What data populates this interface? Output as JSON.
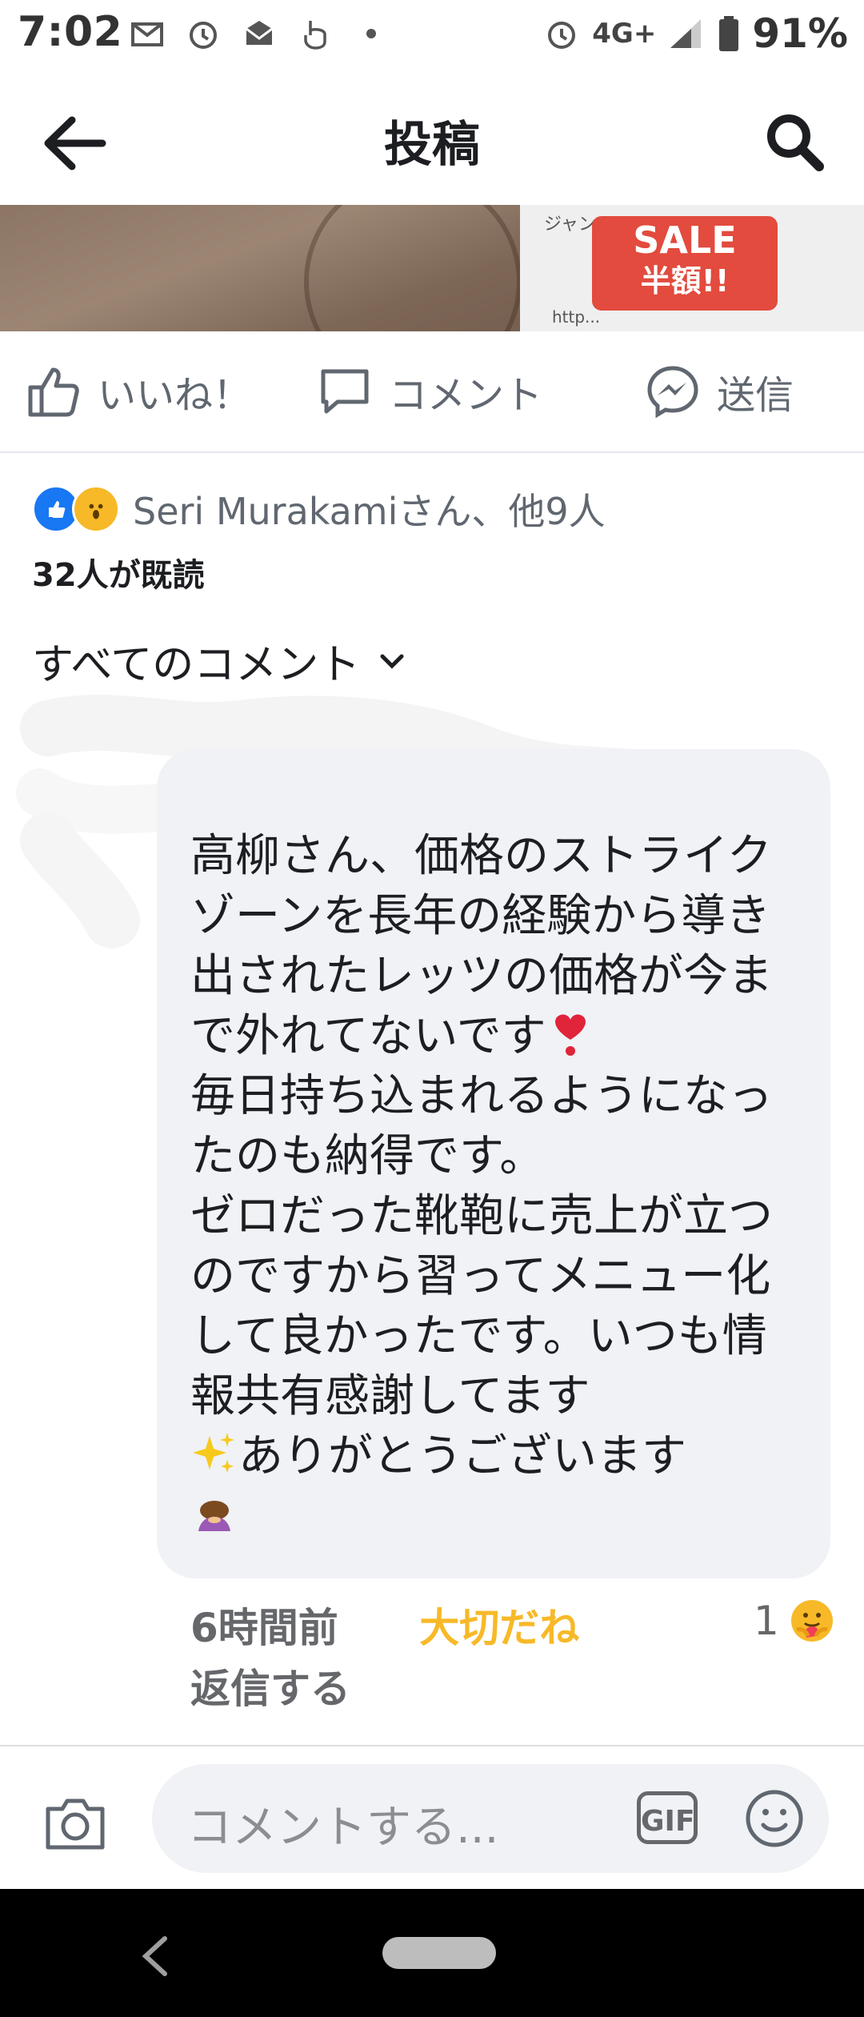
{
  "status_bar": {
    "time": "7:02",
    "network": "4G+",
    "battery": "91%"
  },
  "header": {
    "title": "投稿"
  },
  "photo": {
    "sale_line1": "SALE",
    "sale_line2": "半額!!",
    "paper_label": "ジャンル",
    "http_text": "http..."
  },
  "actions": {
    "like": "いいね！",
    "comment": "コメント",
    "send": "送信"
  },
  "reactions": {
    "summary": "Seri Murakamiさん、他9人",
    "readers": "32人が既読"
  },
  "filter": {
    "label": "すべてのコメント"
  },
  "comment": {
    "text": "高柳さん、価格のストライクゾーンを長年の経験から導き出されたレッツの価格が今まで外れてないです",
    "text2": "毎日持ち込まれるようになったのも納得です。\nゼロだった靴鞄に売上が立つのですから習ってメニュー化して良かったです。いつも情報共有感謝してます",
    "text3": "ありがとうございます",
    "time": "6時間前",
    "reaction_label": "大切だね",
    "reply_label": "返信する",
    "reaction_count": "1"
  },
  "composer": {
    "placeholder": "コメントする...",
    "gif": "GIF"
  },
  "colors": {
    "brand": "#1877f2",
    "care": "#f7b928",
    "bubble": "#f0f2f5"
  }
}
